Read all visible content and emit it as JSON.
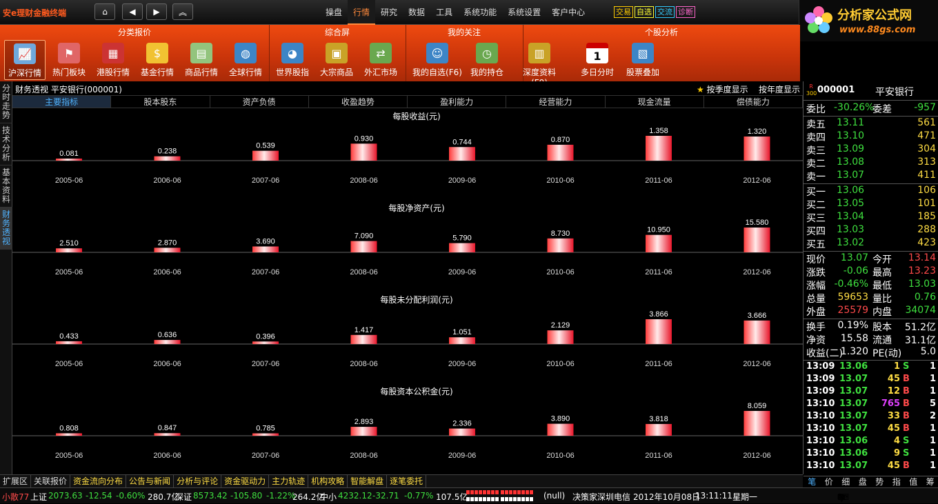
{
  "app": {
    "title": "安e理财金融终端"
  },
  "menu": [
    "操盘",
    "行情",
    "研究",
    "数据",
    "工具",
    "系统功能",
    "系统设置",
    "客户中心"
  ],
  "menu_active": 1,
  "quick_buttons": [
    {
      "label": "交易",
      "color": "#ffcc00"
    },
    {
      "label": "自选",
      "color": "#ffff33"
    },
    {
      "label": "交流",
      "color": "#33ccff"
    },
    {
      "label": "诊断",
      "color": "#ff66cc"
    }
  ],
  "logo": {
    "name": "分析家公式网",
    "url": "www.88gs.com"
  },
  "ribbon_groups": [
    {
      "label": "分类报价",
      "buttons": [
        {
          "label": "沪深行情",
          "icon": "market-chart-icon",
          "color": "#6fa8dc"
        },
        {
          "label": "热门板块",
          "icon": "hot-board-icon",
          "color": "#e06666"
        },
        {
          "label": "港股行情",
          "icon": "hk-stock-icon",
          "color": "#cc3333"
        },
        {
          "label": "基金行情",
          "icon": "fund-icon",
          "color": "#f1c232"
        },
        {
          "label": "商品行情",
          "icon": "commodity-icon",
          "color": "#93c47d"
        },
        {
          "label": "全球行情",
          "icon": "globe-icon",
          "color": "#3d85c6"
        }
      ]
    },
    {
      "label": "综合屏",
      "buttons": [
        {
          "label": "世界股指",
          "icon": "world-index-icon",
          "color": "#3d85c6"
        },
        {
          "label": "大宗商品",
          "icon": "bulk-goods-icon",
          "color": "#c9a227"
        },
        {
          "label": "外汇市场",
          "icon": "forex-icon",
          "color": "#6aa84f"
        }
      ]
    },
    {
      "label": "我的关注",
      "buttons": [
        {
          "label": "我的自选(F6)",
          "icon": "user-watchlist-icon",
          "color": "#3d85c6"
        },
        {
          "label": "我的持仓",
          "icon": "position-clock-icon",
          "color": "#6aa84f"
        }
      ]
    },
    {
      "label": "个股分析",
      "buttons": [
        {
          "label": "深度资料(F9)",
          "icon": "deep-data-icon",
          "color": "#c9a227"
        },
        {
          "label": "多日分时",
          "icon": "calendar-icon",
          "color": "#dddddd"
        },
        {
          "label": "股票叠加",
          "icon": "stock-overlay-icon",
          "color": "#3d85c6"
        }
      ]
    }
  ],
  "calendar_day": "1",
  "left_vtabs": [
    "分时走势",
    "技术分析",
    "基本资料",
    "财务透视"
  ],
  "left_vtab_active": 3,
  "content": {
    "breadcrumb": "财务透视  平安银行(000001)",
    "switch_quarter": "按季度显示",
    "switch_year": "按年度显示",
    "subtabs": [
      "主要指标",
      "股本股东",
      "资产负债",
      "收盈趋势",
      "盈利能力",
      "经营能力",
      "现金流量",
      "偿债能力"
    ]
  },
  "chart_data": [
    {
      "type": "bar",
      "title": "每股收益(元)",
      "categories": [
        "2005-06",
        "2006-06",
        "2007-06",
        "2008-06",
        "2009-06",
        "2010-06",
        "2011-06",
        "2012-06"
      ],
      "values": [
        0.081,
        0.238,
        0.539,
        0.93,
        0.744,
        0.87,
        1.358,
        1.32
      ],
      "labels": [
        "0.081",
        "0.238",
        "0.539",
        "0.930",
        "0.744",
        "0.870",
        "1.358",
        "1.320"
      ]
    },
    {
      "type": "bar",
      "title": "每股净资产(元)",
      "categories": [
        "2005-06",
        "2006-06",
        "2007-06",
        "2008-06",
        "2009-06",
        "2010-06",
        "2011-06",
        "2012-06"
      ],
      "values": [
        2.51,
        2.87,
        3.69,
        7.09,
        5.79,
        8.73,
        10.95,
        15.58
      ],
      "labels": [
        "2.510",
        "2.870",
        "3.690",
        "7.090",
        "5.790",
        "8.730",
        "10.950",
        "15.580"
      ]
    },
    {
      "type": "bar",
      "title": "每股未分配利润(元)",
      "categories": [
        "2005-06",
        "2006-06",
        "2007-06",
        "2008-06",
        "2009-06",
        "2010-06",
        "2011-06",
        "2012-06"
      ],
      "values": [
        0.433,
        0.636,
        0.396,
        1.417,
        1.051,
        2.129,
        3.866,
        3.666
      ],
      "labels": [
        "0.433",
        "0.636",
        "0.396",
        "1.417",
        "1.051",
        "2.129",
        "3.866",
        "3.666"
      ]
    },
    {
      "type": "bar",
      "title": "每股资本公积金(元)",
      "categories": [
        "2005-06",
        "2006-06",
        "2007-06",
        "2008-06",
        "2009-06",
        "2010-06",
        "2011-06",
        "2012-06"
      ],
      "values": [
        0.808,
        0.847,
        0.785,
        2.893,
        2.336,
        3.89,
        3.818,
        8.059
      ],
      "labels": [
        "0.808",
        "0.847",
        "0.785",
        "2.893",
        "2.336",
        "3.890",
        "3.818",
        "8.059"
      ]
    }
  ],
  "stock": {
    "badge_top": "R",
    "badge_bottom": "300",
    "code": "000001",
    "name": "平安银行",
    "weibi": {
      "label": "委比",
      "value": "-30.26%",
      "label2": "委差",
      "value2": "-957"
    },
    "sells": [
      {
        "label": "卖五",
        "price": "13.11",
        "vol": "561"
      },
      {
        "label": "卖四",
        "price": "13.10",
        "vol": "471"
      },
      {
        "label": "卖三",
        "price": "13.09",
        "vol": "304"
      },
      {
        "label": "卖二",
        "price": "13.08",
        "vol": "313"
      },
      {
        "label": "卖一",
        "price": "13.07",
        "vol": "411"
      }
    ],
    "buys": [
      {
        "label": "买一",
        "price": "13.06",
        "vol": "106"
      },
      {
        "label": "买二",
        "price": "13.05",
        "vol": "101"
      },
      {
        "label": "买三",
        "price": "13.04",
        "vol": "185"
      },
      {
        "label": "买四",
        "price": "13.03",
        "vol": "288"
      },
      {
        "label": "买五",
        "price": "13.02",
        "vol": "423"
      }
    ],
    "stats": [
      {
        "l1": "现价",
        "v1": "13.07",
        "c1": "green",
        "l2": "今开",
        "v2": "13.14",
        "c2": "red"
      },
      {
        "l1": "涨跌",
        "v1": "-0.06",
        "c1": "green",
        "l2": "最高",
        "v2": "13.23",
        "c2": "red"
      },
      {
        "l1": "涨幅",
        "v1": "-0.46%",
        "c1": "green",
        "l2": "最低",
        "v2": "13.03",
        "c2": "green"
      },
      {
        "l1": "总量",
        "v1": "59653",
        "c1": "yellow",
        "l2": "量比",
        "v2": "0.76",
        "c2": "green"
      },
      {
        "l1": "外盘",
        "v1": "25579",
        "c1": "red",
        "l2": "内盘",
        "v2": "34074",
        "c2": "green"
      }
    ],
    "stats2": [
      {
        "l1": "换手",
        "v1": "0.19%",
        "l2": "股本",
        "v2": "51.2亿"
      },
      {
        "l1": "净资",
        "v1": "15.58",
        "l2": "流通",
        "v2": "31.1亿"
      },
      {
        "l1": "收益(二)",
        "v1": "1.320",
        "l2": "PE(动)",
        "v2": "5.0"
      }
    ],
    "ticks": [
      {
        "time": "13:09",
        "price": "13.06",
        "vol": "1",
        "side": "S",
        "n": "1",
        "vc": "yellow"
      },
      {
        "time": "13:09",
        "price": "13.07",
        "vol": "45",
        "side": "B",
        "n": "1",
        "vc": "yellow"
      },
      {
        "time": "13:09",
        "price": "13.07",
        "vol": "12",
        "side": "B",
        "n": "1",
        "vc": "yellow"
      },
      {
        "time": "13:10",
        "price": "13.07",
        "vol": "765",
        "side": "B",
        "n": "5",
        "vc": "magenta"
      },
      {
        "time": "13:10",
        "price": "13.07",
        "vol": "33",
        "side": "B",
        "n": "2",
        "vc": "yellow"
      },
      {
        "time": "13:10",
        "price": "13.07",
        "vol": "45",
        "side": "B",
        "n": "1",
        "vc": "yellow"
      },
      {
        "time": "13:10",
        "price": "13.06",
        "vol": "4",
        "side": "S",
        "n": "1",
        "vc": "yellow"
      },
      {
        "time": "13:10",
        "price": "13.06",
        "vol": "9",
        "side": "S",
        "n": "1",
        "vc": "yellow"
      },
      {
        "time": "13:10",
        "price": "13.07",
        "vol": "45",
        "side": "B",
        "n": "1",
        "vc": "yellow"
      }
    ],
    "right_tabs": [
      "笔",
      "价",
      "细",
      "盘",
      "势",
      "指",
      "值",
      "筹"
    ]
  },
  "bottom_tabs": [
    "扩展区",
    "关联报价",
    "资金流向分布",
    "公告与新闻",
    "分析与评论",
    "资金驱动力",
    "主力轨迹",
    "机构攻略",
    "智能解盘",
    "逐笔委托"
  ],
  "status": {
    "xiaosan": "小散77",
    "sh_label": "上证",
    "sh_price": "2073.63",
    "sh_chg": "-12.54",
    "sh_pct": "-0.60%",
    "sh_amt": "280.7亿",
    "sz_label": "深证",
    "sz_price": "8573.42",
    "sz_chg": "-105.80",
    "sz_pct": "-1.22%",
    "sz_amt": "264.2亿",
    "zx_label": "中小",
    "zx_price": "4232.12",
    "zx_chg": "-32.71",
    "zx_pct": "-0.77%",
    "zx_amt": "107.5亿",
    "null_text": "(null)",
    "broker": "决策家深圳电信",
    "date": "2012年10月08日",
    "time": "13:11:11",
    "weekday": "星期一",
    "tray_label": "中"
  }
}
